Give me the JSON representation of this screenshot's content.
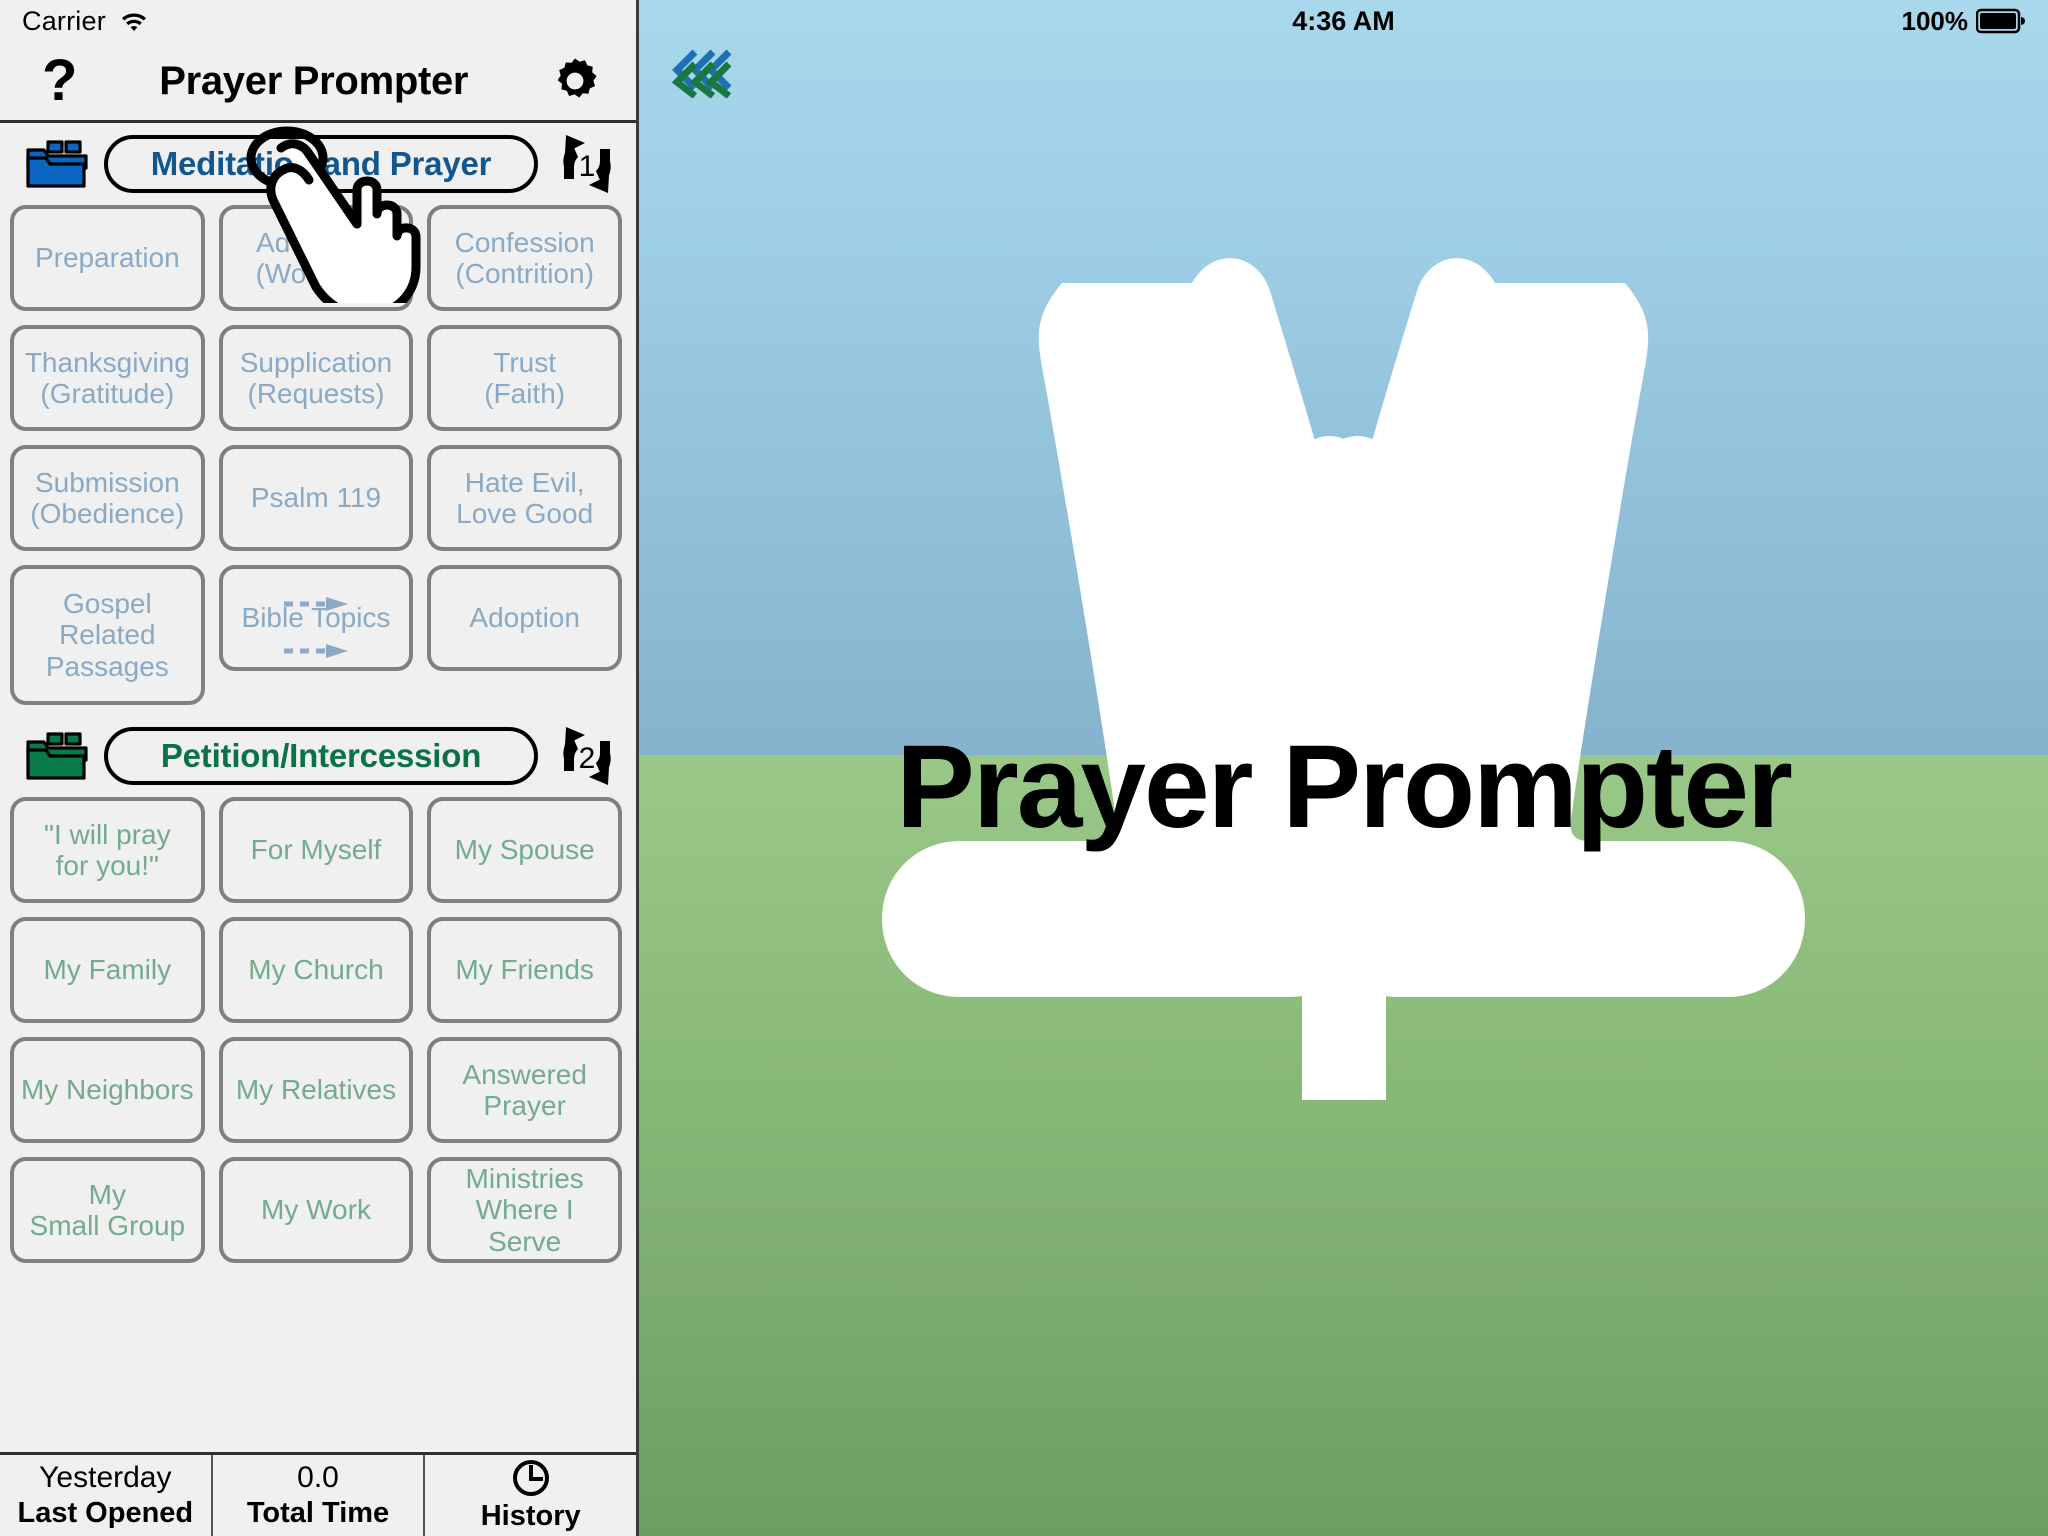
{
  "left_status": {
    "carrier": "Carrier",
    "wifi_icon": "wifi-icon"
  },
  "navbar": {
    "help_label": "?",
    "title": "Prayer Prompter",
    "settings_icon": "gear-icon"
  },
  "sections": [
    {
      "id": "meditation",
      "folder_icon": "blue-folder-stack-icon",
      "title": "Meditation and Prayer",
      "badge": "1",
      "badge_icon": "cycle-repeat-icon",
      "accent": "#11568f",
      "tile_color": "#8aa9c4",
      "tiles": [
        {
          "label": "Preparation"
        },
        {
          "label": "Adoration\n(Worship)"
        },
        {
          "label": "Confession\n(Contrition)"
        },
        {
          "label": "Thanksgiving\n(Gratitude)"
        },
        {
          "label": "Supplication\n(Requests)"
        },
        {
          "label": "Trust\n(Faith)"
        },
        {
          "label": "Submission\n(Obedience)"
        },
        {
          "label": "Psalm 119"
        },
        {
          "label": "Hate Evil,\nLove Good"
        },
        {
          "label": "Gospel\nRelated\nPassages"
        },
        {
          "label": "Bible Topics",
          "has_arrows": true
        },
        {
          "label": "Adoption"
        }
      ]
    },
    {
      "id": "petition",
      "folder_icon": "green-folder-stack-icon",
      "title": "Petition/Intercession",
      "badge": "2",
      "badge_icon": "cycle-repeat-icon",
      "accent": "#0a7243",
      "tile_color": "#73ab8c",
      "tiles": [
        {
          "label": "\"I will pray\nfor you!\""
        },
        {
          "label": "For Myself"
        },
        {
          "label": "My Spouse"
        },
        {
          "label": "My Family"
        },
        {
          "label": "My Church"
        },
        {
          "label": "My Friends"
        },
        {
          "label": "My Neighbors"
        },
        {
          "label": "My Relatives"
        },
        {
          "label": "Answered\nPrayer"
        },
        {
          "label": "My\nSmall Group"
        },
        {
          "label": "My Work"
        },
        {
          "label": "Ministries\nWhere I Serve"
        }
      ]
    }
  ],
  "toolbar": [
    {
      "value": "Yesterday",
      "label": "Last Opened",
      "icon": null
    },
    {
      "value": "0.0",
      "label": "Total Time",
      "icon": null
    },
    {
      "value": null,
      "label": "History",
      "icon": "clock-icon"
    }
  ],
  "right_status": {
    "time": "4:36 AM",
    "battery_percent": "100%",
    "battery_icon": "battery-full-icon"
  },
  "right_panel": {
    "back_icon": "triple-chevron-left-icon",
    "hero_title": "Prayer Prompter",
    "hero_icon": "praying-hands-with-cross-icon"
  },
  "cursor": {
    "icon": "pointing-hand-cursor"
  },
  "colors": {
    "blue_accent": "#11568f",
    "green_accent": "#0a7243",
    "tile_blue": "#8aa9c4",
    "tile_green": "#73ab8c",
    "tile_border": "#808080",
    "panel_bg": "#f0f0f0",
    "sky_top": "#a9d8ec",
    "sky_bottom": "#85b3cd",
    "ground_top": "#9ac888",
    "ground_bottom": "#6e9d62",
    "folder_blue": "#0a66c2",
    "folder_green": "#067a49"
  }
}
